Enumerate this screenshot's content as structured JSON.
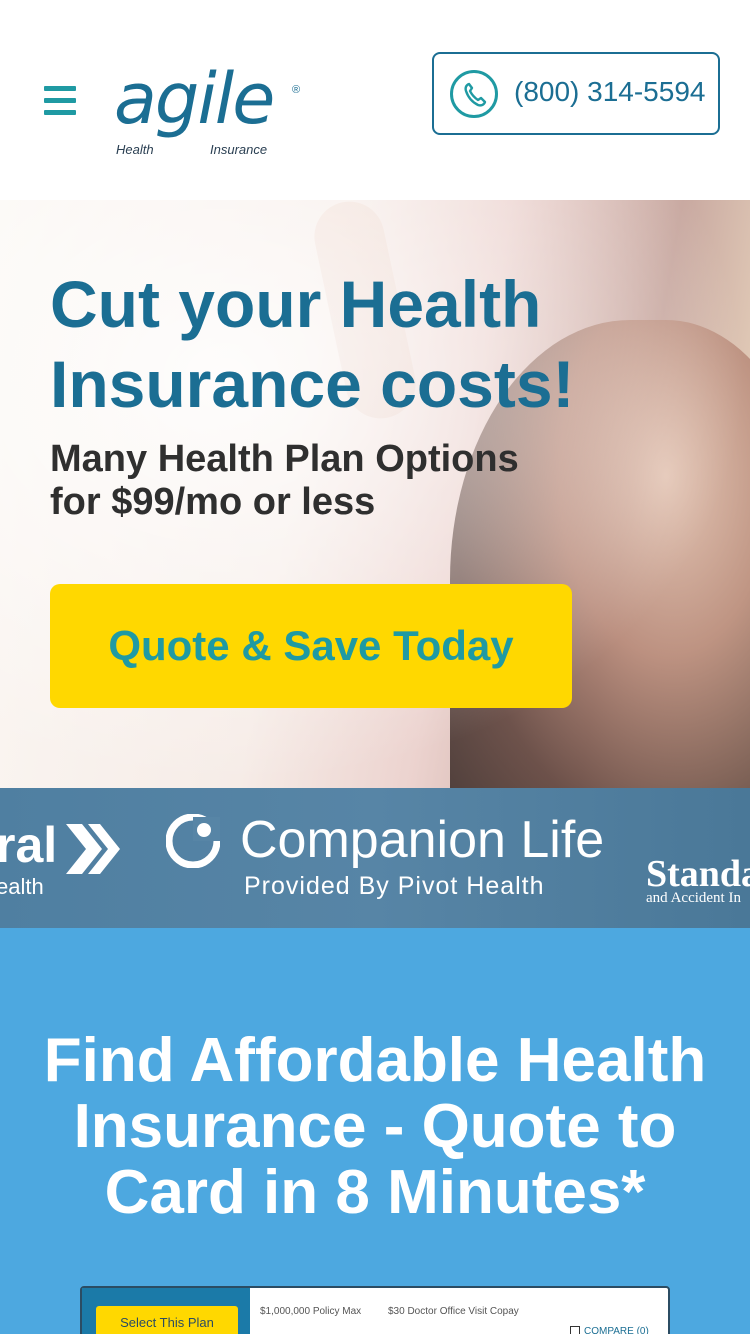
{
  "header": {
    "logo_word": "agile",
    "logo_reg": "®",
    "logo_sub_left": "Health",
    "logo_sub_right": "Insurance",
    "phone": "(800) 314-5594"
  },
  "hero": {
    "headline": "Cut your Health Insurance costs!",
    "subheadline": "Many Health Plan Options for $99/mo or less",
    "cta_label": "Quote & Save Today"
  },
  "carriers": {
    "left_big": "ral",
    "left_small": "ealth",
    "companion_name": "Companion Life",
    "companion_tagline": "Provided By Pivot Health",
    "standard_name": "Standar",
    "standard_sub": "and Accident In"
  },
  "info": {
    "title": "Find Affordable Health Insurance - Quote to Card in 8 Minutes*"
  },
  "plan_preview": {
    "select_label": "Select This Plan",
    "feature_1": "$1,000,000 Policy Max",
    "feature_2": "$30 Doctor Office Visit Copay",
    "compare_label": "COMPARE (0)"
  },
  "colors": {
    "brand_blue": "#1b6e93",
    "accent_teal": "#1f9aa3",
    "cta_yellow": "#ffd800",
    "section_blue": "#4da8e0"
  },
  "icons": [
    "menu-icon",
    "phone-icon",
    "companion-life-logo-icon",
    "chevron-logo-icon"
  ]
}
